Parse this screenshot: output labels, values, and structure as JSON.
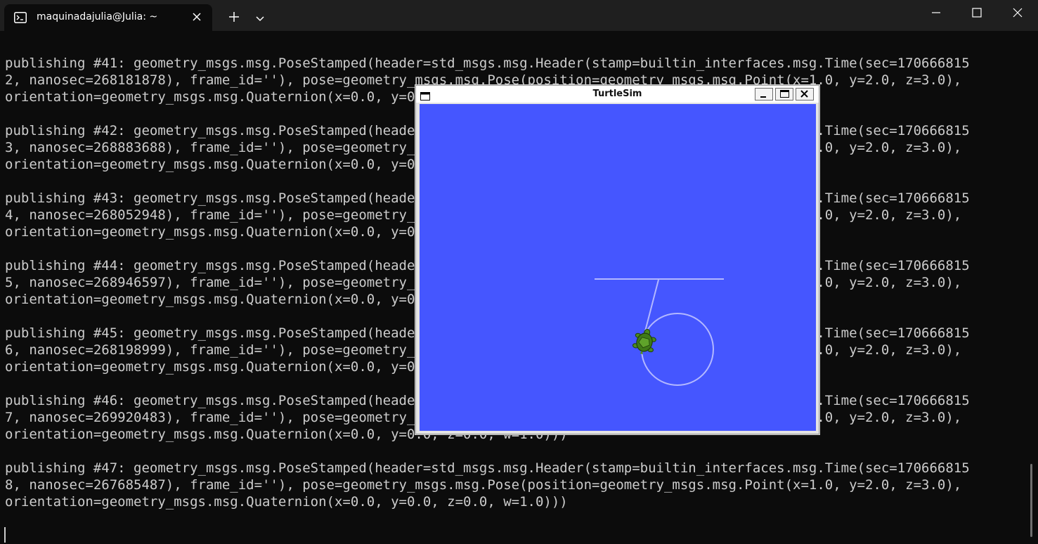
{
  "terminal": {
    "tab_title": "maquinadajulia@Julia: ~",
    "tab_icon": "terminal-icon",
    "lines": [
      [
        "publishing #41: geometry_msgs.msg.PoseStamped(header=std_msgs.msg.Header(stamp=builtin_interfaces.msg.Time(sec=170666815",
        "2, nanosec=268181878), frame_id=''), pose=geometry_msgs.msg.Pose(position=geometry_msgs.msg.Point(x=1.0, y=2.0, z=3.0),",
        "orientation=geometry_msgs.msg.Quaternion(x=0.0, y=0.0, z=0.0, w=1.0)))"
      ],
      [
        "publishing #42: geometry_msgs.msg.PoseStamped(header=std_msgs.msg.Header(stamp=builtin_interfaces.msg.Time(sec=170666815",
        "3, nanosec=268883688), frame_id=''), pose=geometry_msgs.msg.Pose(position=geometry_msgs.msg.Point(x=1.0, y=2.0, z=3.0),",
        "orientation=geometry_msgs.msg.Quaternion(x=0.0, y=0.0, z=0.0, w=1.0)))"
      ],
      [
        "publishing #43: geometry_msgs.msg.PoseStamped(header=std_msgs.msg.Header(stamp=builtin_interfaces.msg.Time(sec=170666815",
        "4, nanosec=268052948), frame_id=''), pose=geometry_msgs.msg.Pose(position=geometry_msgs.msg.Point(x=1.0, y=2.0, z=3.0),",
        "orientation=geometry_msgs.msg.Quaternion(x=0.0, y=0.0, z=0.0, w=1.0)))"
      ],
      [
        "publishing #44: geometry_msgs.msg.PoseStamped(header=std_msgs.msg.Header(stamp=builtin_interfaces.msg.Time(sec=170666815",
        "5, nanosec=268946597), frame_id=''), pose=geometry_msgs.msg.Pose(position=geometry_msgs.msg.Point(x=1.0, y=2.0, z=3.0),",
        "orientation=geometry_msgs.msg.Quaternion(x=0.0, y=0.0, z=0.0, w=1.0)))"
      ],
      [
        "publishing #45: geometry_msgs.msg.PoseStamped(header=std_msgs.msg.Header(stamp=builtin_interfaces.msg.Time(sec=170666815",
        "6, nanosec=268198999), frame_id=''), pose=geometry_msgs.msg.Pose(position=geometry_msgs.msg.Point(x=1.0, y=2.0, z=3.0),",
        "orientation=geometry_msgs.msg.Quaternion(x=0.0, y=0.0, z=0.0, w=1.0)))"
      ],
      [
        "publishing #46: geometry_msgs.msg.PoseStamped(header=std_msgs.msg.Header(stamp=builtin_interfaces.msg.Time(sec=170666815",
        "7, nanosec=269920483), frame_id=''), pose=geometry_msgs.msg.Pose(position=geometry_msgs.msg.Point(x=1.0, y=2.0, z=3.0),",
        "orientation=geometry_msgs.msg.Quaternion(x=0.0, y=0.0, z=0.0, w=1.0)))"
      ],
      [
        "publishing #47: geometry_msgs.msg.PoseStamped(header=std_msgs.msg.Header(stamp=builtin_interfaces.msg.Time(sec=170666815",
        "8, nanosec=267685487), frame_id=''), pose=geometry_msgs.msg.Pose(position=geometry_msgs.msg.Point(x=1.0, y=2.0, z=3.0),",
        "orientation=geometry_msgs.msg.Quaternion(x=0.0, y=0.0, z=0.0, w=1.0)))"
      ]
    ],
    "colors": {
      "background": "#0c0c0c",
      "text": "#cccccc",
      "titlebar": "#1f1f1f"
    }
  },
  "turtlesim": {
    "title": "TurtleSim",
    "colors": {
      "background": "#4556ff",
      "pen": "#b3b8ff",
      "turtle": "#4b8a1f"
    }
  }
}
